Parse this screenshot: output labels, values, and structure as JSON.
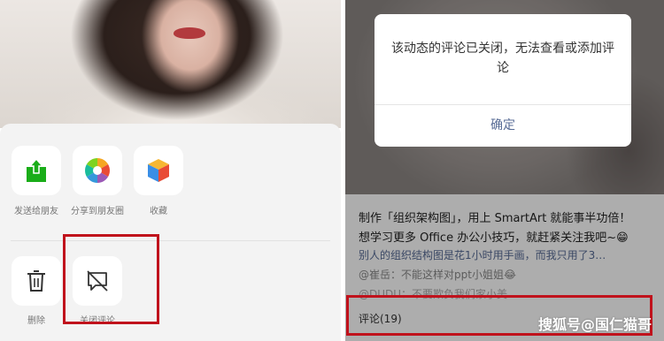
{
  "left_screen": {
    "share_row": [
      {
        "label": "发送给朋友",
        "icon": "send-to-friend-icon"
      },
      {
        "label": "分享到朋友圈",
        "icon": "moments-aperture-icon"
      },
      {
        "label": "收藏",
        "icon": "favorite-cube-icon"
      }
    ],
    "action_row": [
      {
        "label": "删除",
        "icon": "trash-icon"
      },
      {
        "label": "关闭评论",
        "icon": "close-comments-icon"
      }
    ]
  },
  "right_screen": {
    "dialog": {
      "message": "该动态的评论已关闭，无法查看或添加评论",
      "confirm_label": "确定"
    },
    "caption_line1": "制作「组织架构图」，用上 SmartArt 就能事半功倍！",
    "caption_line2": "想学习更多 Office 办公小技巧，就赶紧关注我吧~😁",
    "comment_1": "别人的组织结构图是花1小时用手画，而我只用了3…",
    "comment_2": "@崔岳：不能这样对ppt小姐姐😂",
    "comment_3": "@DUDU：不要欺负我们家小美",
    "comments_label": "评论(19)",
    "watermark": "搜狐号@国仁猫哥"
  },
  "colors": {
    "highlight": "#c0121c",
    "link_blue": "#576b95",
    "moments_green": "#07c160"
  }
}
